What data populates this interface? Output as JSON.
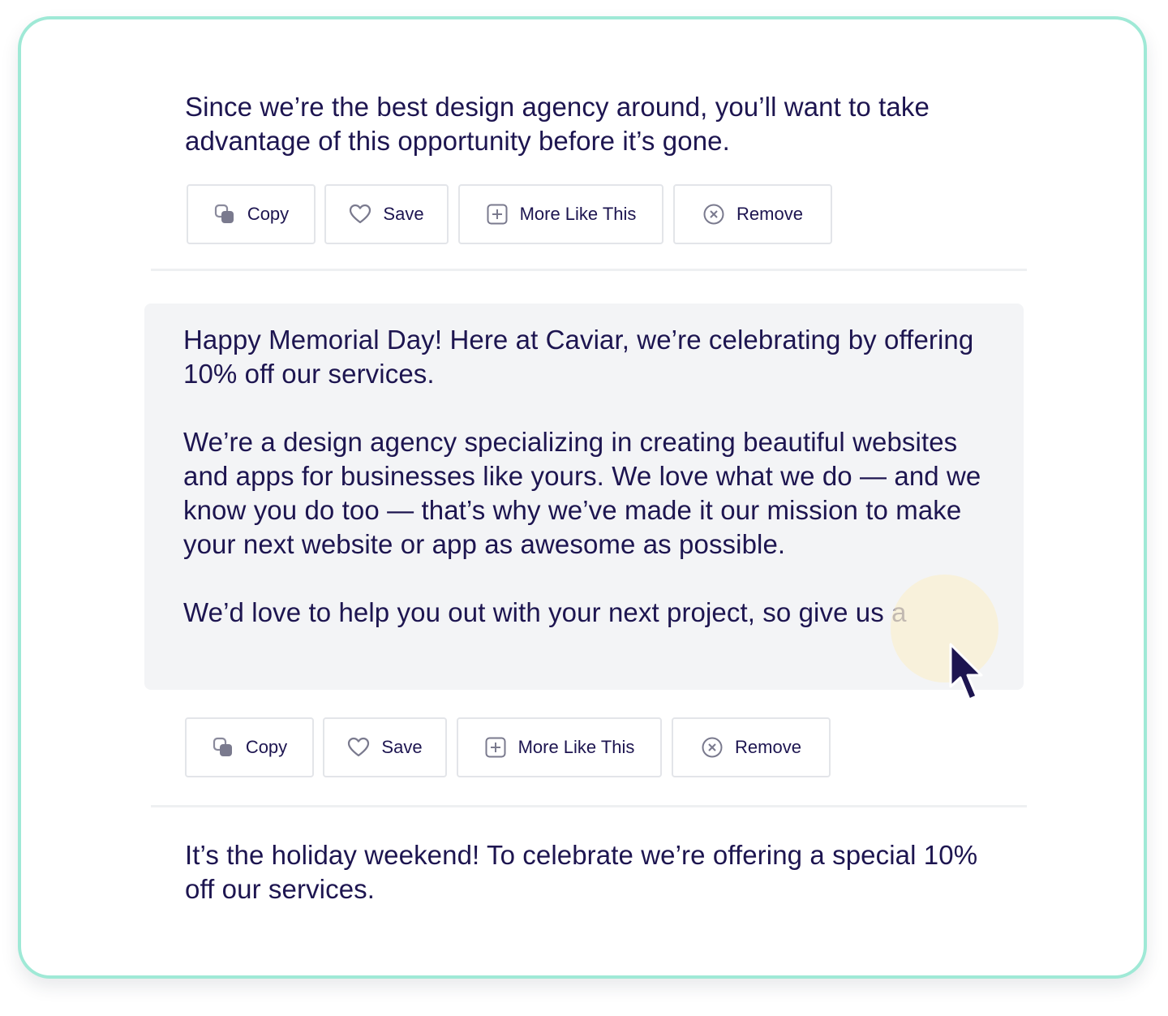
{
  "results": [
    {
      "paragraphs": [
        "Since we’re the best design agency around, you’ll want to take advantage of this opportunity before it’s gone."
      ],
      "actions": {
        "copy": "Copy",
        "save": "Save",
        "more_like_this": "More Like This",
        "remove": "Remove"
      }
    },
    {
      "paragraphs": [
        "Happy Memorial Day! Here at Caviar, we’re celebrating by offering 10% off our services.",
        "We’re a design agency specializing in creating beautiful websites and apps for businesses like yours. We love what we do — and we know you do too — that’s why we’ve made it our mission to make your next website or app as awesome as possible.",
        "We’d love to help you out with your next project, so give us a"
      ],
      "actions": {
        "copy": "Copy",
        "save": "Save",
        "more_like_this": "More Like This",
        "remove": "Remove"
      }
    },
    {
      "paragraphs": [
        "It’s the holiday weekend! To celebrate we’re offering a special 10% off our services."
      ]
    }
  ],
  "icons": {
    "copy": "copy-icon",
    "save": "heart-icon",
    "more_like_this": "plus-square-icon",
    "remove": "x-circle-icon",
    "cursor": "cursor-pointer-icon"
  },
  "colors": {
    "text": "#1d1550",
    "frame_border": "#9fe9d6",
    "highlight_bg": "#f3f4f6",
    "button_border": "#e3e5e9",
    "cursor_halo": "#faf0d2"
  }
}
